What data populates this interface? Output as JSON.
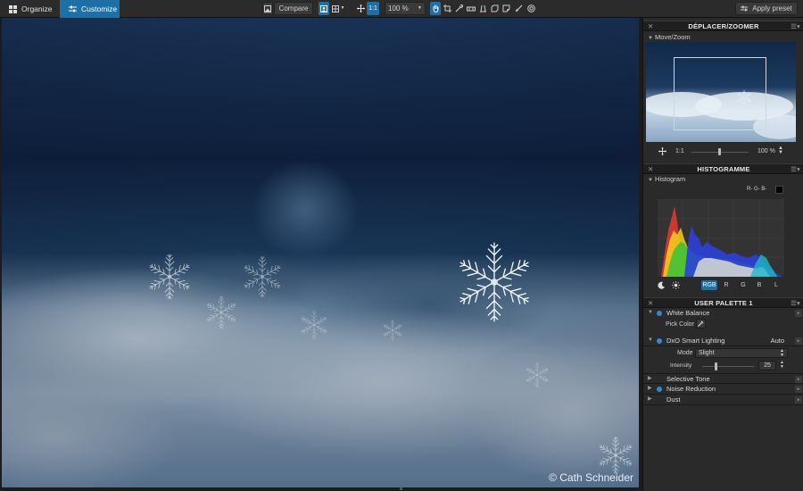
{
  "tabs": {
    "organize": "Organize",
    "customize": "Customize"
  },
  "toolbar": {
    "compare_label": "Compare",
    "fit_label": "1:1",
    "zoom_value": "100 %",
    "apply_preset_label": "Apply preset"
  },
  "image": {
    "watermark": "© Cath Schneider"
  },
  "nav_panel": {
    "title": "DÉPLACER/ZOOMER",
    "subtitle": "Move/Zoom",
    "one_to_one": "1:1",
    "zoom_value": "100 %"
  },
  "hist_panel": {
    "title": "HISTOGRAMME",
    "subtitle": "Histogram",
    "rgb_readout": "R- G- B-",
    "channels": [
      "RGB",
      "R",
      "G",
      "B",
      "L"
    ]
  },
  "palette": {
    "title": "USER PALETTE 1",
    "white_balance": {
      "label": "White Balance",
      "pick_color": "Pick Color"
    },
    "smart_lighting": {
      "label": "DxO Smart Lighting",
      "value": "Auto",
      "mode_label": "Mode",
      "mode_value": "Slight",
      "intensity_label": "Intensity",
      "intensity_value": "25",
      "intensity_level": 0.25
    },
    "selective_tone": "Selective Tone",
    "noise_reduction": "Noise Reduction",
    "dust": "Dust"
  },
  "colors": {
    "accent": "#1d6fa5",
    "active_dot": "#2e8bd0"
  }
}
